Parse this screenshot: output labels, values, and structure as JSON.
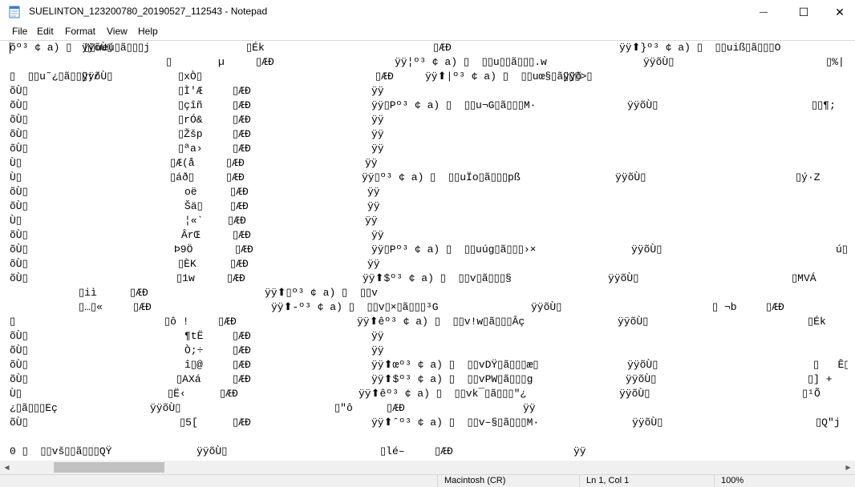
{
  "window": {
    "title": "SUELINTON_123200780_20190527_112543 - Notepad",
    "minimize_glyph": "—",
    "maximize_glyph": "☐",
    "close_glyph": "✕"
  },
  "menu": [
    "File",
    "Edit",
    "Format",
    "View",
    "Help"
  ],
  "editor": {
    "lines": [
      [
        "õº³ ¢ a) ▯  ▯▯ueú▯ã▯▯▯j",
        "ÿÿõÙ▯",
        "▯Ék",
        "▯ÆÐ",
        "ÿÿ⬆}º³ ¢ a) ▯  ▯▯uiß▯ã▯▯▯O"
      ],
      [
        "▯",
        "µ",
        "▯ÆÐ",
        "ÿÿ¦º³ ¢ a) ▯  ▯▯u▯▯ã▯▯▯.w",
        "ÿÿõÙ▯",
        "▯%|"
      ],
      [
        "▯  ▯▯u˜¿▯ã▯▯▯:/",
        "ÿÿõÙ▯",
        "▯xÒ▯",
        "▯ÆÐ",
        "ÿÿ⬆|º³ ¢ a) ▯  ▯▯uœ§▯ã▯▯▯>▯",
        "ÿÿõ"
      ],
      [
        "õÙ▯",
        "▯Ì'Æ",
        "▯ÆÐ",
        "ÿÿ"
      ],
      [
        "õÙ▯",
        "▯çîñ",
        "▯ÆÐ",
        "ÿÿ▯Pº³ ¢ a) ▯  ▯▯u¬G▯ã▯▯▯M·",
        "ÿÿõÙ▯",
        "▯▯¶;"
      ],
      [
        "õÙ▯",
        "▯rÓ&",
        "▯ÆÐ",
        "ÿÿ"
      ],
      [
        "õÙ▯",
        "▯Žšp",
        "▯ÆÐ",
        "ÿÿ"
      ],
      [
        "õÙ▯",
        "▯ªa›",
        "▯ÆÐ",
        "ÿÿ"
      ],
      [
        "Ù▯",
        "▯Æ(å",
        "▯ÆÐ",
        "ÿÿ"
      ],
      [
        "Ù▯",
        "▯áð▯",
        "▯ÆÐ",
        "ÿÿ▯º³ ¢ a) ▯  ▯▯uÏo▯ã▯▯▯pß",
        "ÿÿõÙ▯",
        "▯ý·Z"
      ],
      [
        "õÙ▯",
        "oë",
        "▯ÆÐ",
        "ÿÿ"
      ],
      [
        "õÙ▯",
        "Šä▯",
        "▯ÆÐ",
        "ÿÿ"
      ],
      [
        "Ù▯",
        "¦«`",
        "▯ÆÐ",
        "ÿÿ"
      ],
      [
        "õÙ▯",
        "ÂrŒ",
        "▯ÆÐ",
        "ÿÿ"
      ],
      [
        "õÙ▯",
        "Þ9Ö",
        "▯ÆÐ",
        "ÿÿ▯Pº³ ¢ a) ▯  ▯▯uúg▯ã▯▯▯›×",
        "ÿÿõÙ▯",
        "ú▯▯"
      ],
      [
        "õÙ▯",
        "▯ÈK",
        "▯ÆÐ",
        "ÿÿ"
      ],
      [
        "õÙ▯",
        "▯1w",
        "▯ÆÐ",
        "ÿÿ⬆$º³ ¢ a) ▯  ▯▯v▯ã▯▯▯§",
        "ÿÿõÙ▯",
        "▯MVÁ"
      ],
      [
        "▯iì",
        "▯ÆÐ",
        "ÿÿ⬆▯º³ ¢ a) ▯  ▯▯v"
      ],
      [
        "▯…▯«",
        "▯ÆÐ",
        "ÿÿ⬆-º³ ¢ a) ▯  ▯▯v▯×▯ã▯▯▯³G",
        "ÿÿõÙ▯",
        "▯ ¬b",
        "▯ÆÐ"
      ],
      [
        "▯",
        "▯ô !",
        "▯ÆÐ",
        "ÿÿ⬆êº³ ¢ a) ▯  ▯▯v!w▯ã▯▯▯Âç",
        "ÿÿõÙ▯",
        "▯Ék"
      ],
      [
        "õÙ▯",
        "¶tË",
        "▯ÆÐ",
        "ÿÿ"
      ],
      [
        "õÙ▯",
        "Ò;÷",
        "▯ÆÐ",
        "ÿÿ"
      ],
      [
        "õÙ▯",
        "î▯@",
        "▯ÆÐ",
        "ÿÿ⬆œº³ ¢ a) ▯  ▯▯vDŸ▯ã▯▯▯æ▯",
        "ÿÿõÙ▯",
        "▯   Ê▯"
      ],
      [
        "õÙ▯",
        "▯AXá",
        "▯ÆÐ",
        "ÿÿ⬆$º³ ¢ a) ▯  ▯▯vPW▯ã▯▯▯g",
        "ÿÿõÙ▯",
        "▯] +"
      ],
      [
        "Ù▯",
        "▯Ë‹",
        "▯ÆÐ",
        "ÿÿ⬆êº³ ¢ a) ▯  ▯▯vk¯▯ã▯▯▯\"¿",
        "ÿÿõÙ▯",
        "▯¹Õ"
      ],
      [
        "¿▯ã▯▯▯Eç",
        "ÿÿõÙ▯",
        "▯\"ô",
        "▯ÆÐ",
        "ÿÿ"
      ],
      [
        "õÙ▯",
        "▯5[",
        "▯ÆÐ",
        "ÿÿ⬆ˆº³ ¢ a) ▯  ▯▯v–§▯ã▯▯▯M·",
        "ÿÿõÙ▯",
        "▯Q\"j"
      ],
      [
        ""
      ],
      [
        "0 ▯  ▯▯vš▯▯ã▯▯▯QŸ",
        "ÿÿõÙ▯",
        "▯lé–",
        "▯ÆÐ",
        "ÿÿ"
      ]
    ]
  },
  "statusbar": {
    "encoding": "Macintosh (CR)",
    "position": "Ln 1, Col 1",
    "zoom": "100%"
  }
}
